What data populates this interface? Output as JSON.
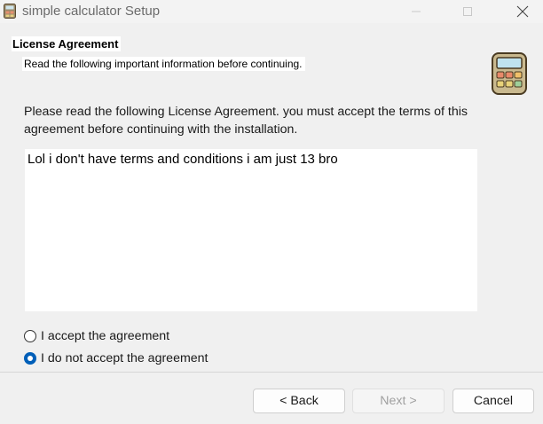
{
  "window": {
    "title": "simple calculator Setup",
    "app_icon": "calculator-icon"
  },
  "header": {
    "title": "License Agreement",
    "subtitle": "Read the following important information before continuing.",
    "icon": "calculator-icon"
  },
  "main": {
    "intro": "Please read the following License Agreement. you must accept the terms of this agreement before continuing with the installation.",
    "license_text": "Lol i don't have terms and conditions i am just 13 bro",
    "options": [
      {
        "label": "I accept the agreement",
        "selected": false
      },
      {
        "label": "I do not accept the agreement",
        "selected": true
      }
    ]
  },
  "footer": {
    "back_label": "< Back",
    "next_label": "Next >",
    "cancel_label": "Cancel"
  },
  "colors": {
    "accent": "#005fb8",
    "background": "#f0f0f0"
  }
}
